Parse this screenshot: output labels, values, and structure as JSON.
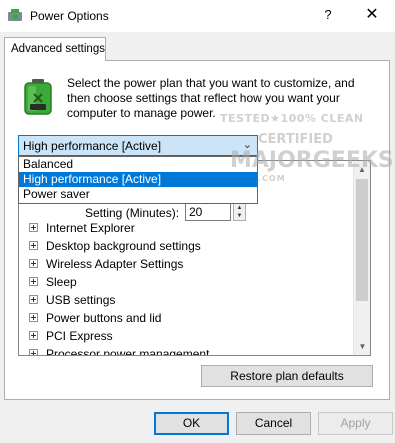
{
  "window": {
    "title": "Power Options",
    "help_glyph": "?",
    "close_glyph": "✕",
    "icon": "power-options-icon"
  },
  "tabs": [
    {
      "label": "Advanced settings",
      "active": true
    }
  ],
  "intro_text": "Select the power plan that you want to customize, and then choose settings that reflect how you want your computer to manage power.",
  "plan_select": {
    "value": "High performance [Active]",
    "arrow": "⌄",
    "options": [
      "Balanced",
      "High performance [Active]",
      "Power saver"
    ],
    "highlighted_index": 1
  },
  "settings": {
    "spin_label": "Setting (Minutes):",
    "spin_value": "20",
    "items": [
      "Internet Explorer",
      "Desktop background settings",
      "Wireless Adapter Settings",
      "Sleep",
      "USB settings",
      "Power buttons and lid",
      "PCI Express",
      "Processor power management"
    ]
  },
  "buttons": {
    "restore": "Restore plan defaults",
    "ok": "OK",
    "cancel": "Cancel",
    "apply": "Apply"
  },
  "watermark": {
    "line1": "TESTED★100% CLEAN",
    "line2": "CERTIFIED",
    "line3": "MAJORGEEKS",
    "line4": ".COM"
  },
  "colors": {
    "accent": "#0078d7",
    "selection_background": "#cce4f7",
    "battery_green": "#3aa935"
  }
}
